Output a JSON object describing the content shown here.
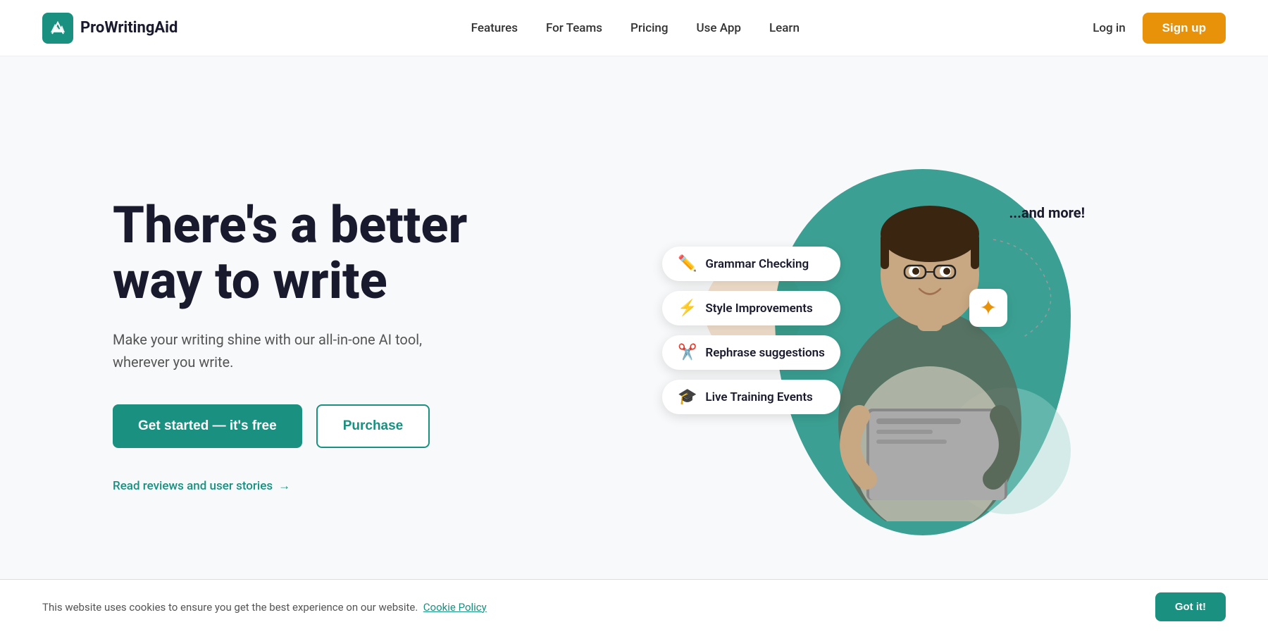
{
  "brand": {
    "name": "ProWritingAid",
    "logo_alt": "ProWritingAid logo"
  },
  "nav": {
    "links": [
      {
        "id": "features",
        "label": "Features"
      },
      {
        "id": "for-teams",
        "label": "For Teams"
      },
      {
        "id": "pricing",
        "label": "Pricing"
      },
      {
        "id": "use-app",
        "label": "Use App"
      },
      {
        "id": "learn",
        "label": "Learn"
      }
    ],
    "login_label": "Log in",
    "signup_label": "Sign up"
  },
  "hero": {
    "title_line1": "There's a better",
    "title_line2": "way to write",
    "subtitle": "Make your writing shine with our all-in-one AI tool, wherever you write.",
    "cta_primary": "Get started  —  it's free",
    "cta_secondary": "Purchase",
    "reviews_link": "Read reviews and user stories"
  },
  "features": [
    {
      "id": "grammar",
      "icon": "✏️",
      "label": "Grammar Checking"
    },
    {
      "id": "style",
      "icon": "⚡",
      "label": "Style Improvements"
    },
    {
      "id": "rephrase",
      "icon": "✂️",
      "label": "Rephrase suggestions"
    },
    {
      "id": "training",
      "icon": "🎓",
      "label": "Live Training Events"
    }
  ],
  "and_more": "...and more!",
  "sparkle": "✦",
  "cookie": {
    "text": "This website uses cookies to ensure you get the best experience on our website.",
    "link_label": "Cookie Policy",
    "button_label": "Got it!"
  }
}
